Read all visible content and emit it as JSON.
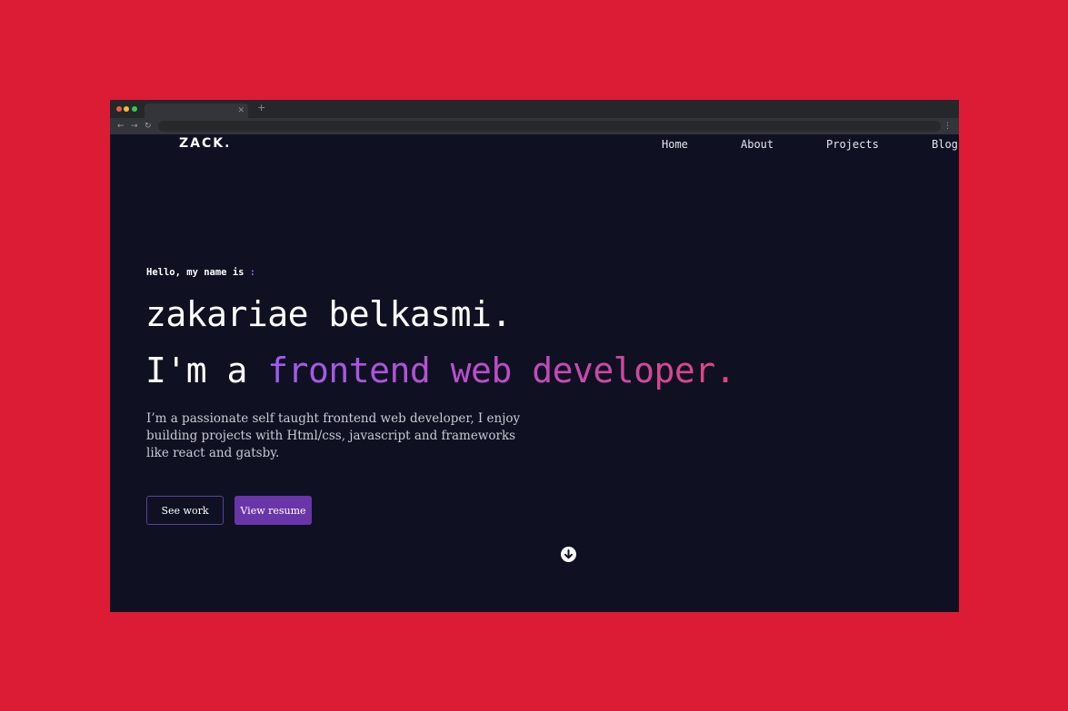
{
  "header": {
    "logo": "ZACK.",
    "nav": [
      "Home",
      "About",
      "Projects",
      "Blog"
    ]
  },
  "hero": {
    "greeting": "Hello, my name is ",
    "greeting_colon": ":",
    "name": "zakariae belkasmi.",
    "tagline_lead": "I'm a ",
    "tagline_highlight": "frontend web developer.",
    "bio_lines": [
      "I’m a passionate self taught frontend web developer, I enjoy",
      "building projects with Html/css, javascript and frameworks",
      "like react and gatsby."
    ],
    "buttons": {
      "see_work": "See work",
      "view_resume": "View resume"
    }
  },
  "icons": {
    "scroll_down": "arrow-down-circle-icon"
  },
  "colors": {
    "background": "#dc1c35",
    "page": "#0f1123",
    "accent": "#6a35a8",
    "gradient_start": "#9f5cf0",
    "gradient_end": "#e0457a"
  }
}
